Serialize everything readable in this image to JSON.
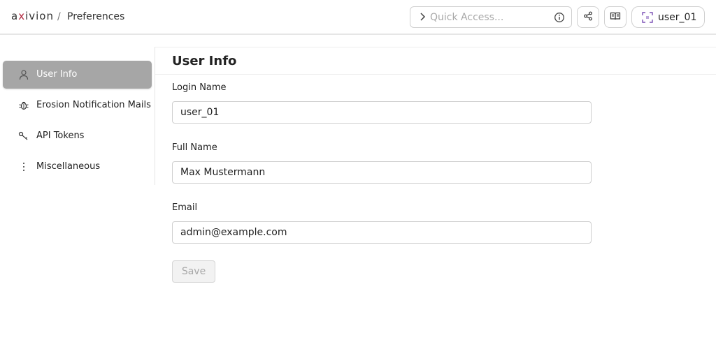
{
  "header": {
    "logo_text": "axivion",
    "breadcrumb_separator": "/",
    "breadcrumb": "Preferences",
    "quick_access_placeholder": "Quick Access...",
    "user_name": "user_01"
  },
  "sidebar": {
    "items": [
      {
        "label": "User Info",
        "icon": "person-icon",
        "active": true
      },
      {
        "label": "Erosion Notification Mails",
        "icon": "bug-icon",
        "active": false
      },
      {
        "label": "API Tokens",
        "icon": "key-icon",
        "active": false
      },
      {
        "label": "Miscellaneous",
        "icon": "more-vertical-icon",
        "active": false
      }
    ]
  },
  "main": {
    "title": "User Info",
    "fields": [
      {
        "label": "Login Name",
        "value": "user_01"
      },
      {
        "label": "Full Name",
        "value": "Max Mustermann"
      },
      {
        "label": "Email",
        "value": "admin@example.com"
      }
    ],
    "save_label": "Save"
  },
  "colors": {
    "accent_logo": "#b0223a",
    "sidebar_active_bg": "#a6a6a6",
    "user_icon_accent": "#7a4fb5"
  }
}
